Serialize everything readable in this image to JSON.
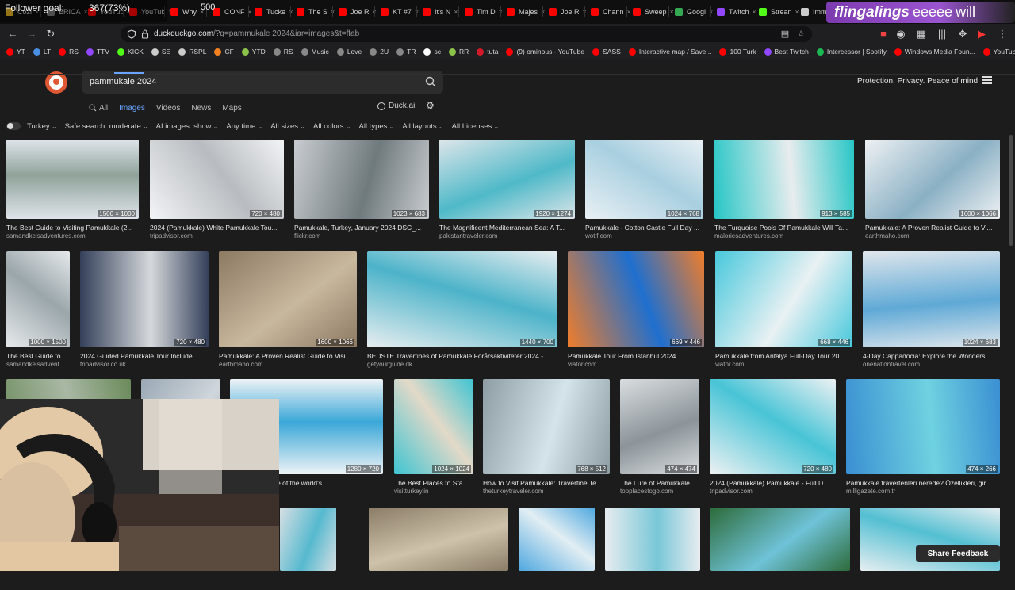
{
  "overlay": {
    "follower_goal": "Follower goal:",
    "follower_stats": "367(73%)",
    "goal_target": "500",
    "banner_name": "flingalings",
    "banner_tail": "eeeee",
    "banner_tail2": "will"
  },
  "tabs": [
    {
      "label": "Cozi",
      "color": "#e6b325"
    },
    {
      "label": "ERICA",
      "color": "#7a7a7a"
    },
    {
      "label": "YouTub",
      "color": "#ff0000"
    },
    {
      "label": "YouTub",
      "color": "#ff0000"
    },
    {
      "label": "Why",
      "color": "#ff0000"
    },
    {
      "label": "CONF",
      "color": "#ff0000"
    },
    {
      "label": "Tucke",
      "color": "#ff0000"
    },
    {
      "label": "The S",
      "color": "#ff0000"
    },
    {
      "label": "Joe R",
      "color": "#ff0000"
    },
    {
      "label": "KT #7",
      "color": "#ff0000"
    },
    {
      "label": "It's N",
      "color": "#ff0000"
    },
    {
      "label": "Tim D",
      "color": "#ff0000"
    },
    {
      "label": "Majes",
      "color": "#ff0000"
    },
    {
      "label": "Joe R",
      "color": "#ff0000"
    },
    {
      "label": "Chann",
      "color": "#ff0000"
    },
    {
      "label": "Sweep",
      "color": "#ff0000"
    },
    {
      "label": "Googl",
      "color": "#34a853"
    },
    {
      "label": "Twitch",
      "color": "#9146ff"
    },
    {
      "label": "Strean",
      "color": "#53fc18"
    },
    {
      "label": "Immin",
      "color": "#cccccc"
    }
  ],
  "address": {
    "url_host": "duckduckgo.com",
    "url_rest": "/?q=pammukale 2024&iar=images&t=ffab"
  },
  "bookmarks": [
    {
      "label": "YT",
      "color": "#ff0000"
    },
    {
      "label": "LT",
      "color": "#4a90e2"
    },
    {
      "label": "RS",
      "color": "#ff0000"
    },
    {
      "label": "TTV",
      "color": "#9146ff"
    },
    {
      "label": "KICK",
      "color": "#53fc18"
    },
    {
      "label": "SE",
      "color": "#cccccc"
    },
    {
      "label": "RSPL",
      "color": "#cccccc"
    },
    {
      "label": "CF",
      "color": "#f38020"
    },
    {
      "label": "YTD",
      "color": "#8bc34a"
    },
    {
      "label": "RS",
      "color": "#888888"
    },
    {
      "label": "Music",
      "color": "#888888"
    },
    {
      "label": "Love",
      "color": "#888888"
    },
    {
      "label": "2U",
      "color": "#888888"
    },
    {
      "label": "TR",
      "color": "#888888"
    },
    {
      "label": "sc",
      "color": "#ffffff"
    },
    {
      "label": "RR",
      "color": "#8bc34a"
    },
    {
      "label": "tuta",
      "color": "#d11a2a"
    },
    {
      "label": "(9) ominous - YouTube",
      "color": "#ff0000"
    },
    {
      "label": "SASS",
      "color": "#ff0000"
    },
    {
      "label": "Interactive map / Save...",
      "color": "#ff0000"
    },
    {
      "label": "100 Turk",
      "color": "#ff0000"
    },
    {
      "label": "Best Twitch",
      "color": "#9146ff"
    },
    {
      "label": "Intercessor | Spotify",
      "color": "#1db954"
    },
    {
      "label": "Windows Media Foun...",
      "color": "#ff0000"
    },
    {
      "label": "YouTube Music",
      "color": "#ff0000"
    }
  ],
  "search": {
    "query": "pammukale 2024",
    "tagline": "Protection. Privacy. Peace of mind."
  },
  "verticals": [
    "All",
    "Images",
    "Videos",
    "News",
    "Maps"
  ],
  "duckai": "Duck.ai",
  "filters": [
    "Turkey",
    "Safe search: moderate",
    "AI images: show",
    "Any time",
    "All sizes",
    "All colors",
    "All types",
    "All layouts",
    "All Licenses"
  ],
  "rows": [
    [
      {
        "caption": "The Best Guide to Visiting Pamukkale (2...",
        "source": "samandkelsadventures.com",
        "dims": "1500 × 1000",
        "c1": "#dfe4ea",
        "c2": "#8fa39a"
      },
      {
        "caption": "2024 (Pamukkale) White Pamukkale Tou...",
        "source": "tripadvisor.com",
        "dims": "720 × 480",
        "c1": "#f2f4f6",
        "c2": "#b8bcc0"
      },
      {
        "caption": "Pamukkale, Turkey, January 2024 DSC_...",
        "source": "flickr.com",
        "dims": "1023 × 683",
        "c1": "#c9ccd0",
        "c2": "#6f7a7d"
      },
      {
        "caption": "The Magnificent Mediterranean Sea: A T...",
        "source": "pakistantraveler.com",
        "dims": "1920 × 1274",
        "c1": "#dde5ea",
        "c2": "#4fb9c8"
      },
      {
        "caption": "Pamukkale - Cotton Castle Full Day ...",
        "source": "wotif.com",
        "dims": "1024 × 768",
        "c1": "#e9f0f4",
        "c2": "#a8cfe0"
      },
      {
        "caption": "The Turquoise Pools Of Pamukkale Will Ta...",
        "source": "maloriesadventures.com",
        "dims": "913 × 585",
        "c1": "#27c6c6",
        "c2": "#e8ecee"
      },
      {
        "caption": "Pamukkale: A Proven Realist Guide to Vi...",
        "source": "earthmaho.com",
        "dims": "1600 × 1066",
        "c1": "#eef1f3",
        "c2": "#8ab0c4"
      }
    ],
    [
      {
        "caption": "The Best Guide to...",
        "source": "samandkelsadvent...",
        "dims": "1000 × 1500",
        "c1": "#e6e9ec",
        "c2": "#9aa6aa"
      },
      {
        "caption": "2024 Guided Pamukkale Tour Include...",
        "source": "tripadvisor.co.uk",
        "dims": "720 × 480",
        "c1": "#34405a",
        "c2": "#d6d9dc"
      },
      {
        "caption": "Pamukkale: A Proven Realist Guide to Visi...",
        "source": "earthmaho.com",
        "dims": "1600 × 1066",
        "c1": "#8c7a62",
        "c2": "#c8b89e"
      },
      {
        "caption": "BEDSTE Travertines of Pamukkale Forårsaktiviteter 2024 -...",
        "source": "getyourguide.dk",
        "dims": "1440 × 700",
        "c1": "#e8eef0",
        "c2": "#4cb3c9"
      },
      {
        "caption": "Pamukkale Tour From Istanbul 2024",
        "source": "viator.com",
        "dims": "669 × 446",
        "c1": "#f07d2a",
        "c2": "#1f6fcf"
      },
      {
        "caption": "Pamukkale from Antalya Full-Day Tour 20...",
        "source": "viator.com",
        "dims": "668 × 446",
        "c1": "#48c8dc",
        "c2": "#e9f1f3"
      },
      {
        "caption": "4-Day Cappadocia: Explore the Wonders ...",
        "source": "onenationtravel.com",
        "dims": "1024 × 683",
        "c1": "#dfe6ec",
        "c2": "#5fa9d6"
      }
    ],
    [
      {
        "caption": "",
        "source": "",
        "dims": "",
        "c1": "#6a8a5a",
        "c2": "#a9b8a4"
      },
      {
        "caption": "",
        "source": "",
        "dims": "",
        "c1": "#9aa8b4",
        "c2": "#cfd6dc"
      },
      {
        "caption": "been named one of the world's...",
        "source": ".au",
        "dims": "1280 × 720",
        "c1": "#eef3f6",
        "c2": "#3aa7d8"
      },
      {
        "caption": "The Best Places to Sta...",
        "source": "visitturkey.in",
        "dims": "1024 × 1024",
        "c1": "#3ec4d2",
        "c2": "#e3d9c8"
      },
      {
        "caption": "How to Visit Pamukkale: Travertine Te...",
        "source": "theturkeytraveler.com",
        "dims": "768 × 512",
        "c1": "#8e9da4",
        "c2": "#d4e4ea"
      },
      {
        "caption": "The Lure of Pamukkale...",
        "source": "topplacestogo.com",
        "dims": "474 × 474",
        "c1": "#d9dde0",
        "c2": "#8c9499"
      },
      {
        "caption": "2024 (Pamukkale) Pamukkale - Full D...",
        "source": "tripadvisor.com",
        "dims": "720 × 480",
        "c1": "#edf1f3",
        "c2": "#48c4d6"
      },
      {
        "caption": "Pamukkale travertenleri nerede? Özellikleri, gir...",
        "source": "milligazete.com.tr",
        "dims": "474 × 266",
        "c1": "#3a8fd2",
        "c2": "#6fd2e0"
      }
    ],
    [
      {
        "caption": "",
        "source": "",
        "dims": "",
        "c1": "#d7dfe3",
        "c2": "#56b9cf"
      },
      {
        "caption": "",
        "source": "",
        "dims": "",
        "c1": "#8a7c66",
        "c2": "#cfc2aa"
      },
      {
        "caption": "",
        "source": "",
        "dims": "",
        "c1": "#4fa8e0",
        "c2": "#e2eef3"
      },
      {
        "caption": "",
        "source": "",
        "dims": "",
        "c1": "#e7ecef",
        "c2": "#79c7d8"
      },
      {
        "caption": "",
        "source": "",
        "dims": "",
        "c1": "#2d6b3a",
        "c2": "#6fc3d8"
      },
      {
        "caption": "",
        "source": "",
        "dims": "",
        "c1": "#e6eef1",
        "c2": "#53bfd2"
      }
    ]
  ],
  "share_feedback": "Share Feedback"
}
